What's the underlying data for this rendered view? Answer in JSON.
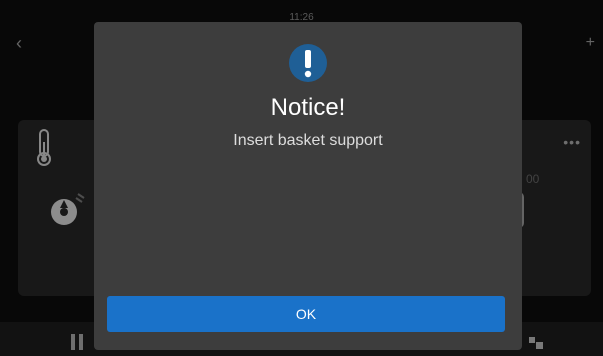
{
  "status_bar": {
    "time": "11:26"
  },
  "nav": {
    "back_icon": "chevron-left-icon",
    "add_icon": "plus-icon"
  },
  "background_card": {
    "icons": [
      "thermometer-icon",
      "fan-icon",
      "more-icon"
    ],
    "more_label": "•••",
    "faded_value": "00"
  },
  "bottom_bar": {
    "icons": [
      "pause-icon",
      "control-icon"
    ]
  },
  "dialog": {
    "icon": "exclamation-icon",
    "title": "Notice!",
    "message": "Insert basket support",
    "ok_label": "OK",
    "accent_color": "#1a72c9",
    "icon_color": "#1f5f96"
  }
}
